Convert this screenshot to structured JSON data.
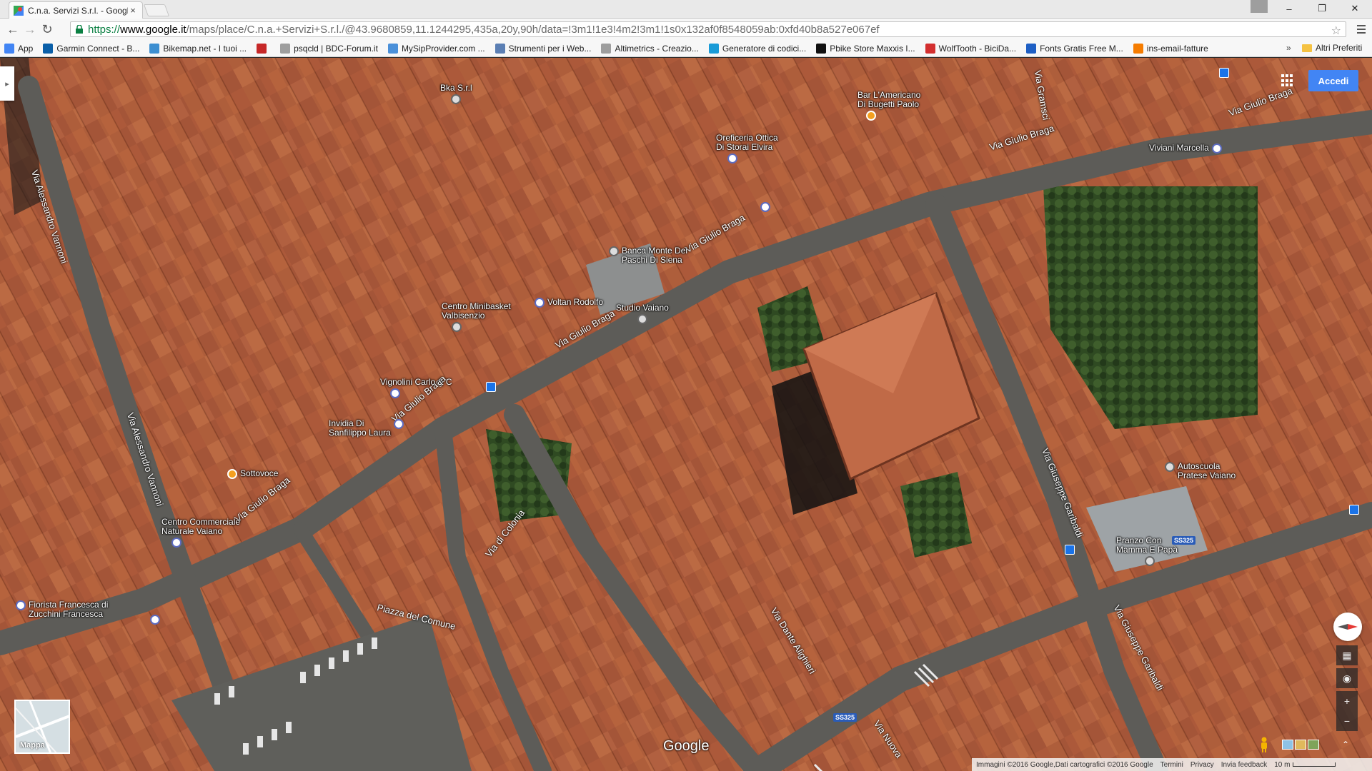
{
  "tab": {
    "title": "C.n.a. Servizi S.r.l. - Google",
    "close": "×"
  },
  "window": {
    "minimize": "–",
    "maximize": "❐",
    "close": "✕"
  },
  "toolbar": {
    "url_secure": "https://",
    "url_host": "www.google.it",
    "url_path": "/maps/place/C.n.a.+Servizi+S.r.l./@43.9680859,11.1244295,435a,20y,90h/data=!3m1!1e3!4m2!3m1!1s0x132af0f8548059ab:0xfd40b8a527e067ef"
  },
  "bookmarks": {
    "items": [
      {
        "label": "App",
        "color": "#4285f4"
      },
      {
        "label": "Garmin Connect - B...",
        "color": "#0a5fa8"
      },
      {
        "label": "Bikemap.net - I tuoi ...",
        "color": "#3d8fd1"
      },
      {
        "label": "",
        "color": "#c62828"
      },
      {
        "label": "psqcld | BDC-Forum.it",
        "color": "#9e9e9e"
      },
      {
        "label": "MySipProvider.com ...",
        "color": "#4a90d9"
      },
      {
        "label": "Strumenti per i Web...",
        "color": "#5b7fb4"
      },
      {
        "label": "Altimetrics - Creazio...",
        "color": "#9e9e9e"
      },
      {
        "label": "Generatore di codici...",
        "color": "#1a9bd7"
      },
      {
        "label": "Pbike Store Maxxis I...",
        "color": "#111111"
      },
      {
        "label": "WolfTooth - BiciDa...",
        "color": "#d32f2f"
      },
      {
        "label": "Fonts Gratis Free M...",
        "color": "#1e5fc4"
      },
      {
        "label": "ins-email-fatture",
        "color": "#f57c00"
      }
    ],
    "more": "»",
    "other": "Altri Preferiti"
  },
  "map": {
    "signin": "Accedi",
    "minimap_label": "Mappa",
    "logo": "Google",
    "footer": {
      "imagery": "Immagini ©2016 Google,Dati cartografici ©2016 Google",
      "terms": "Termini",
      "privacy": "Privacy",
      "feedback": "Invia feedback",
      "scale": "10 m"
    },
    "pois": [
      {
        "name": "Bka S.r.l",
        "type": "gray"
      },
      {
        "name": "Bar L'Americano\nDi Bugetti Paolo",
        "type": "orange"
      },
      {
        "name": "Oreficeria Ottica\nDi Storai Elvira",
        "type": "blue"
      },
      {
        "name": "Viviani Marcella",
        "type": "blue"
      },
      {
        "name": "Banca Monte Dei\nPaschi Di Siena",
        "type": "gray"
      },
      {
        "name": "Centro Minibasket\nValbisenzio",
        "type": "gray"
      },
      {
        "name": "Voltan Rodolfo",
        "type": "blue"
      },
      {
        "name": "Studio Vaiano",
        "type": "gray"
      },
      {
        "name": "Vignolini Carlo & C",
        "type": "blue"
      },
      {
        "name": "Invidia Di\nSanfilippo Laura",
        "type": "blue"
      },
      {
        "name": "Sottovoce",
        "type": "orange"
      },
      {
        "name": "Centro Commerciale\nNaturale Vaiano",
        "type": "blue"
      },
      {
        "name": "Fiorista Francesca di\nZucchini Francesca",
        "type": "blue"
      },
      {
        "name": "Autoscuola\nPratese Vaiano",
        "type": "gray"
      },
      {
        "name": "Pranzo Con\nMamma E Papà",
        "type": "gray"
      }
    ],
    "streets": [
      "Via Giulio Braga",
      "Via Giulio Braga",
      "Via Giulio Braga",
      "Via Giulio Braga",
      "Via Giulio Braga",
      "Via Giulio Braga",
      "Via Alessandro Vannoni",
      "Via Alessandro Vannoni",
      "Via Giuseppe Garibaldi",
      "Via Giuseppe Garibaldi",
      "Via Dante Alighieri",
      "Piazza del Comune",
      "Via di Colonia",
      "Via Nuova",
      "Via Gramsci"
    ],
    "shields": [
      "SS325",
      "SS325"
    ]
  }
}
